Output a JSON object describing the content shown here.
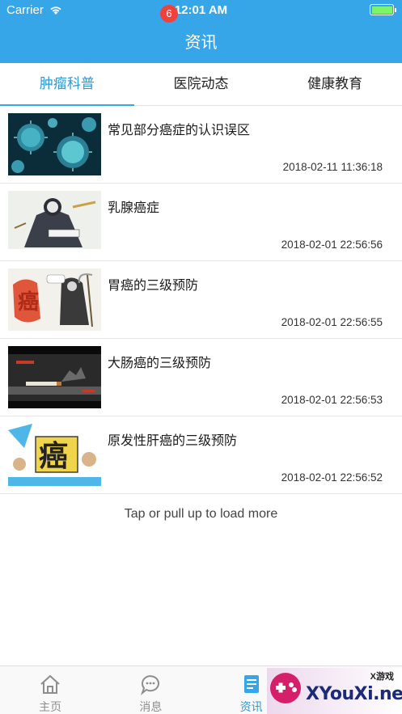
{
  "status_bar": {
    "carrier": "Carrier",
    "time": "12:01 AM",
    "battery_level": 1.0
  },
  "header": {
    "title": "资讯"
  },
  "tabs": [
    {
      "label": "肿瘤科普",
      "active": true
    },
    {
      "label": "医院动态",
      "active": false
    },
    {
      "label": "健康教育",
      "active": false
    }
  ],
  "articles": [
    {
      "title": "常见部分癌症的认识误区",
      "date": "2018-02-11 11:36:18",
      "thumb": "virus-cells-image"
    },
    {
      "title": "乳腺癌症",
      "date": "2018-02-01 22:56:56",
      "thumb": "cancer-cartoon-image"
    },
    {
      "title": "胃癌的三级预防",
      "date": "2018-02-01 22:56:55",
      "thumb": "grim-reaper-cartoon-image"
    },
    {
      "title": "大肠癌的三级预防",
      "date": "2018-02-01 22:56:53",
      "thumb": "smoking-ad-image"
    },
    {
      "title": "原发性肝癌的三级预防",
      "date": "2018-02-01 22:56:52",
      "thumb": "cancer-character-cartoon-image"
    }
  ],
  "load_more": "Tap or pull up to load more",
  "tabbar": {
    "items": [
      {
        "label": "主页",
        "icon": "home-icon",
        "active": false
      },
      {
        "label": "消息",
        "icon": "chat-icon",
        "active": false,
        "badge": "6"
      },
      {
        "label": "资讯",
        "icon": "news-icon",
        "active": true
      },
      {
        "label": "",
        "icon": "profile-icon",
        "active": false
      }
    ]
  },
  "watermark": {
    "text": "XYouXi.net",
    "small": "X游戏"
  },
  "colors": {
    "accent": "#37a6e8",
    "active_tab": "#2a9ad6",
    "badge": "#f0413c"
  }
}
